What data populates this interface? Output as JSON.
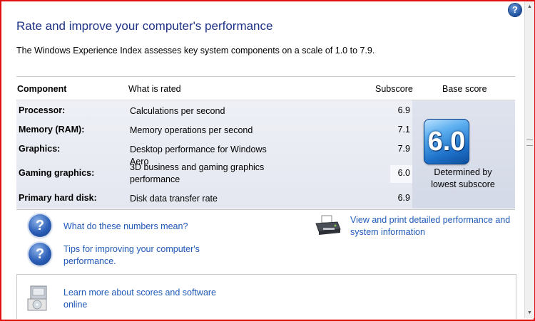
{
  "header": {
    "help_glyph": "?",
    "title": "Rate and improve your computer's performance",
    "intro": "The Windows Experience Index assesses key system components on a scale of 1.0 to 7.9."
  },
  "table": {
    "columns": {
      "component": "Component",
      "what": "What is rated",
      "subscore": "Subscore",
      "base": "Base score"
    },
    "rows": [
      {
        "name": "Processor:",
        "desc": "Calculations per second",
        "score": "6.9"
      },
      {
        "name": "Memory (RAM):",
        "desc": "Memory operations per second",
        "score": "7.1"
      },
      {
        "name": "Graphics:",
        "desc": "Desktop performance for Windows Aero",
        "score": "7.9"
      },
      {
        "name": "Gaming graphics:",
        "desc": "3D business and gaming graphics performance",
        "score": "6.0"
      },
      {
        "name": "Primary hard disk:",
        "desc": "Disk data transfer rate",
        "score": "6.9"
      }
    ],
    "base_score": "6.0",
    "base_label": "Determined by lowest subscore"
  },
  "links": {
    "numbers": "What do these numbers mean?",
    "tips": "Tips for improving your computer's performance.",
    "print": "View and print detailed performance and system information",
    "learn": "Learn more about scores and software online"
  },
  "colors": {
    "title": "#1e3287",
    "link": "#1f59b8",
    "frame": "#e01010"
  }
}
